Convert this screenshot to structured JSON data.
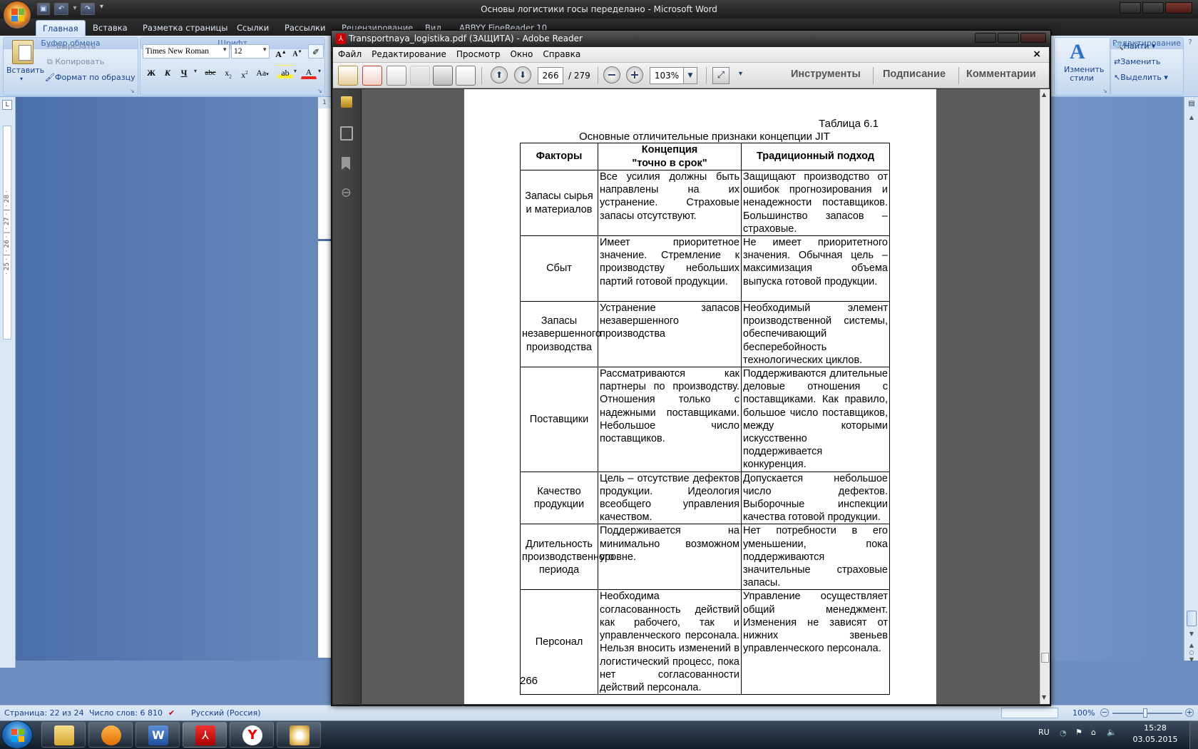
{
  "word": {
    "title": "Основы логистики госы переделано - Microsoft Word",
    "tabs": [
      "Главная",
      "Вставка",
      "Разметка страницы",
      "Ссылки",
      "Рассылки",
      "Рецензирование",
      "Вид",
      "ABBYY FineReader 10"
    ],
    "clipboard": {
      "paste": "Вставить",
      "cut": "Вырезать",
      "copy": "Копировать",
      "format_painter": "Формат по образцу",
      "group": "Буфер обмена"
    },
    "font": {
      "name": "Times New Roman",
      "size": "12",
      "group": "Шрифт"
    },
    "styles": {
      "change_styles": "Изменить стили"
    },
    "editing": {
      "find": "Найти",
      "replace": "Заменить",
      "select": "Выделить",
      "group": "Редактирование"
    },
    "ruler_left": "· 25 · | · 26 · | · 27 · | · 28 ·",
    "status": {
      "page": "Страница: 22 из 24",
      "words": "Число слов: 6 810",
      "language": "Русский (Россия)",
      "zoom": "100%"
    }
  },
  "reader": {
    "title": "Transportnaya_logistika.pdf (ЗАЩИТА) - Adobe Reader",
    "menu": [
      "Файл",
      "Редактирование",
      "Просмотр",
      "Окно",
      "Справка"
    ],
    "page_current": "266",
    "page_total": "/ 279",
    "zoom": "103%",
    "links": [
      "Инструменты",
      "Подписание",
      "Комментарии"
    ]
  },
  "pdf": {
    "table_no": "Таблица 6.1",
    "caption": "Основные отличительные признаки концепции JIT",
    "headers": [
      "Факторы",
      "Концепция \"точно в срок\"",
      "Традиционный подход"
    ],
    "rows": [
      {
        "factor": "Запасы сырья и материалов",
        "jit": "Все усилия должны быть направлены на их устранение. Страховые запасы отсутствуют.",
        "trad": "Защищают производство от ошибок прогнозирования и ненадежности поставщиков. Большинство запасов – страховые."
      },
      {
        "factor": "Сбыт",
        "jit": "Имеет приоритетное значение. Стремление к производству небольших партий готовой продукции.",
        "trad": "Не имеет приоритетного значения. Обычная цель – максимизация объема выпуска готовой продукции."
      },
      {
        "factor": "Запасы незавершенного производства",
        "jit": "Устранение запасов незавершенного производства",
        "trad": "Необходимый элемент производственной системы, обеспечивающий бесперебойность технологических циклов."
      },
      {
        "factor": "Поставщики",
        "jit": "Рассматриваются как партнеры по производству. Отношения только с надежными поставщиками. Небольшое число поставщиков.",
        "trad": "Поддерживаются длительные деловые отношения с поставщиками. Как правило, большое число поставщиков, между которыми искусственно поддерживается конкуренция."
      },
      {
        "factor": "Качество продукции",
        "jit": "Цель – отсутствие дефектов продукции. Идеология всеобщего управления качеством.",
        "trad": "Допускается небольшое число дефектов. Выборочные инспекции качества готовой продукции."
      },
      {
        "factor": "Длительность производственного периода",
        "jit": "Поддерживается на минимально возможном уровне.",
        "trad": "Нет потребности в его уменьшении, пока поддерживаются значительные страховые запасы."
      },
      {
        "factor": "Персонал",
        "jit": "Необходима согласованность действий как рабочего, так и управленческого персонала. Нельзя вносить изменений в логистический процесс, пока нет согласованности действий персонала.",
        "trad": "Управление осуществляет общий менеджмент. Изменения не зависят от нижних звеньев управленческого персонала."
      }
    ],
    "page_number": "266"
  },
  "tray": {
    "lang": "RU",
    "time": "15:28",
    "date": "03.05.2015"
  }
}
